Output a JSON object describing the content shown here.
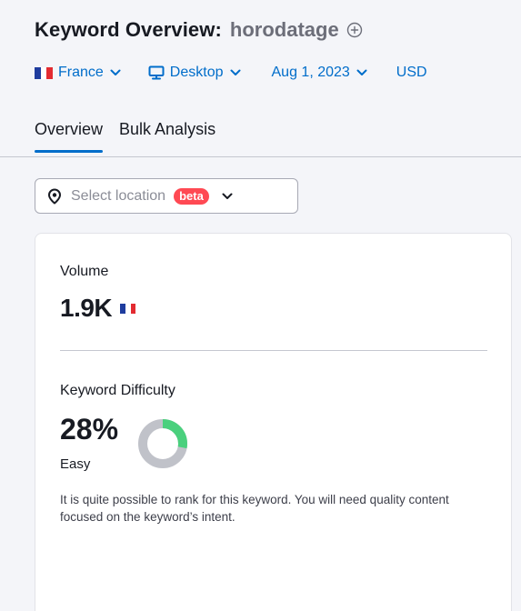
{
  "header": {
    "title": "Keyword Overview:",
    "keyword": "horodatage"
  },
  "filters": {
    "country": "France",
    "device": "Desktop",
    "date": "Aug 1, 2023",
    "currency": "USD"
  },
  "tabs": [
    {
      "label": "Overview",
      "active": true
    },
    {
      "label": "Bulk Analysis",
      "active": false
    }
  ],
  "location": {
    "placeholder": "Select location",
    "badge": "beta"
  },
  "volume": {
    "label": "Volume",
    "value": "1.9K"
  },
  "difficulty": {
    "label": "Keyword Difficulty",
    "value": "28%",
    "percent": 28,
    "level": "Easy",
    "description": "It is quite possible to rank for this keyword. You will need quality content focused on the keyword’s intent."
  },
  "colors": {
    "link": "#006dca",
    "beta": "#ff4953",
    "difficulty_fill": "#4ad07d",
    "difficulty_track": "#c0c2c9",
    "flag_blue": "#1f3c9e",
    "flag_white": "#ffffff",
    "flag_red": "#e32b31"
  },
  "icons": {
    "add": "plus-circle-icon",
    "device": "monitor-icon",
    "location": "map-pin-icon",
    "dropdown": "chevron-down-icon"
  }
}
